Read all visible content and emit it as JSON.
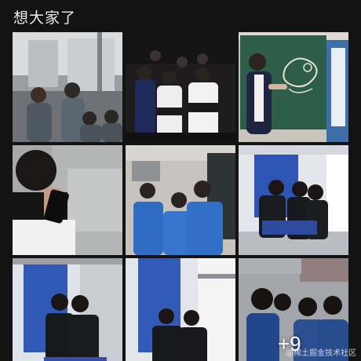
{
  "post": {
    "text": "想大家了"
  },
  "gallery": {
    "photos": [
      {
        "icon": "photo-two-students-at-window"
      },
      {
        "icon": "photo-group-in-uniforms-dark"
      },
      {
        "icon": "photo-student-at-blackboard"
      },
      {
        "icon": "photo-student-on-phone"
      },
      {
        "icon": "photo-three-students-blue-shirts"
      },
      {
        "icon": "photo-students-dorm-bunk"
      },
      {
        "icon": "photo-two-students-dorm-curtain"
      },
      {
        "icon": "photo-two-students-dorm-bunk"
      },
      {
        "icon": "photo-group-selfie"
      }
    ],
    "more_count": "+9"
  },
  "watermark": "@稀土掘金技术社区",
  "colors": {
    "background": "#131313",
    "text": "#eaeaea"
  }
}
